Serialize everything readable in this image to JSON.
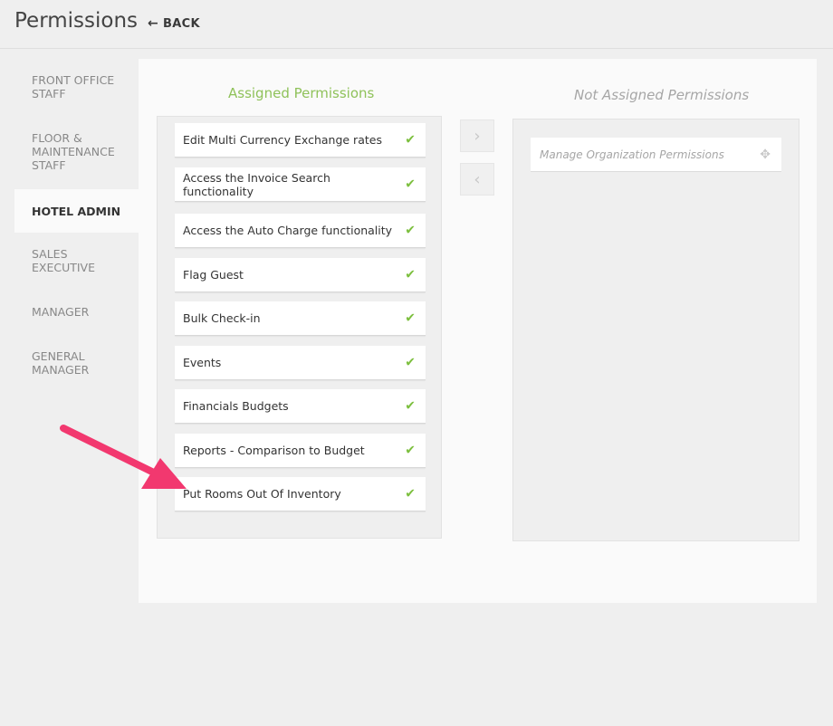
{
  "header": {
    "title": "Permissions",
    "back_label": "BACK"
  },
  "sidebar": {
    "items": [
      {
        "label": "FRONT OFFICE STAFF",
        "active": false
      },
      {
        "label": "FLOOR & MAINTENANCE STAFF",
        "active": false
      },
      {
        "label": "HOTEL ADMIN",
        "active": true
      },
      {
        "label": "SALES EXECUTIVE",
        "active": false
      },
      {
        "label": "MANAGER",
        "active": false
      },
      {
        "label": "GENERAL MANAGER",
        "active": false
      }
    ]
  },
  "assigned": {
    "title": "Assigned Permissions",
    "items": [
      "Edit Multi Currency Exchange rates",
      "Access the Invoice Search functionality",
      "Access the Auto Charge functionality",
      "Flag Guest",
      "Bulk Check-in",
      "Events",
      "Financials Budgets",
      "Reports - Comparison to Budget",
      "Put Rooms Out Of Inventory"
    ]
  },
  "not_assigned": {
    "title": "Not Assigned Permissions",
    "items": [
      "Manage Organization Permissions"
    ]
  },
  "icons": {
    "back": "arrow-left-icon",
    "assigned_item": "checkmark-icon",
    "not_assigned_item": "move-icon",
    "move_right": "chevron-right-icon",
    "move_left": "chevron-left-icon"
  },
  "colors": {
    "assigned_title": "#8fc25a",
    "check": "#7cbf3e",
    "annotation_arrow": "#f2386f"
  }
}
